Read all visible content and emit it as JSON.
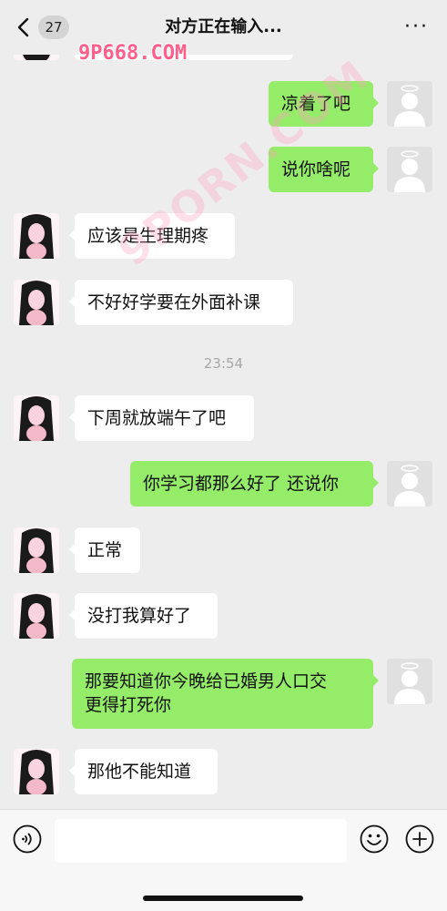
{
  "header": {
    "back_label": "back",
    "unread_count": "27",
    "title": "对方正在输入...",
    "more_label": "···"
  },
  "watermark": {
    "top_text": "9P668.COM",
    "diagonal_text": "9PORN.COM"
  },
  "messages": [
    {
      "side": "right",
      "text": "凉着了吧"
    },
    {
      "side": "right",
      "text": "说你啥呢"
    },
    {
      "side": "left",
      "text": "应该是生理期疼"
    },
    {
      "side": "left",
      "text": "不好好学要在外面补课"
    },
    {
      "side": "left",
      "text": "下周就放端午了吧"
    },
    {
      "side": "right",
      "text": "你学习都那么好了 还说你"
    },
    {
      "side": "left",
      "text": "正常"
    },
    {
      "side": "left",
      "text": "没打我算好了"
    },
    {
      "side": "right",
      "text": "那要知道你今晚给已婚男人口交\n更得打死你"
    },
    {
      "side": "left",
      "text": "那他不能知道"
    }
  ],
  "timestamp": "23:54",
  "input": {
    "value": "",
    "placeholder": ""
  },
  "icons": {
    "back": "chevron-left-icon",
    "more": "more-dots-icon",
    "voice": "voice-icon",
    "emoji": "emoji-icon",
    "plus": "plus-icon"
  },
  "colors": {
    "background": "#ededed",
    "bubble_right": "#95ec69",
    "bubble_left": "#ffffff",
    "watermark": "#ff5f8a"
  }
}
